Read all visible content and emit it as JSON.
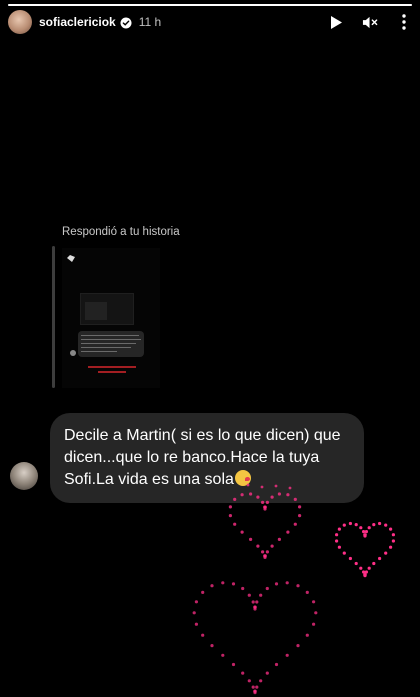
{
  "story": {
    "progress": 1.0,
    "username": "sofiaclericiok",
    "time": "11 h",
    "icons": {
      "verified": "verified-badge-icon",
      "play": "play-icon",
      "mute": "mute-icon",
      "more": "more-icon"
    }
  },
  "reply": {
    "label": "Respondió a tu historia"
  },
  "message": {
    "text": "Decile a Martin( si es lo que dicen) que dicen...que lo re banco.Hace la tuya Sofi.La vida es una sola",
    "emoji": "kiss-emoji"
  },
  "colors": {
    "background": "#000000",
    "bubble": "#262626",
    "heart_dots": "#ff2f87",
    "thumb_red": "#a31e22"
  }
}
